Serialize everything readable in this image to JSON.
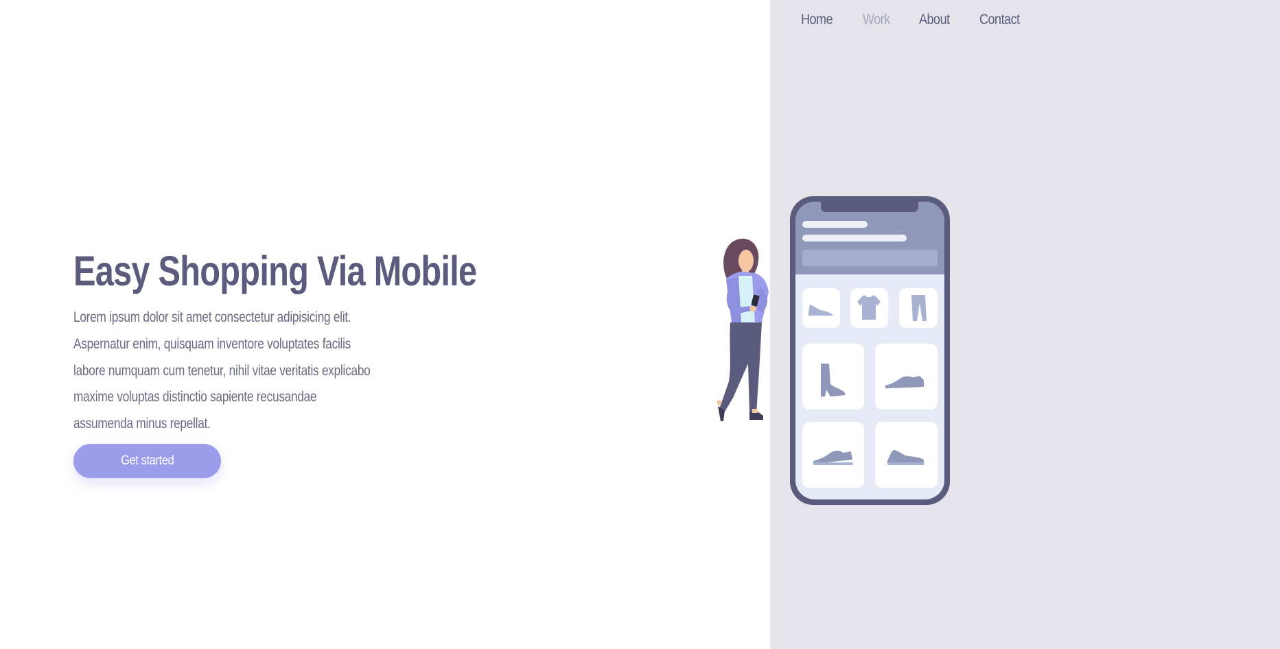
{
  "nav": {
    "items": [
      {
        "label": "Home"
      },
      {
        "label": "Work"
      },
      {
        "label": "About"
      },
      {
        "label": "Contact"
      }
    ]
  },
  "hero": {
    "title": "Easy Shopping Via Mobile",
    "description": "Lorem ipsum dolor sit amet consectetur adipisicing elit. Aspernatur enim, quisquam inventore voluptates facilis labore numquam cum tenetur, nihil vitae veritatis explicabo maxime voluptas distinctio sapiente recusandae assumenda minus repellat.",
    "cta_label": "Get started"
  },
  "colors": {
    "primary_text": "#5b5b7e",
    "muted_nav": "#a5a5bc",
    "accent": "#9c9cec",
    "panel_bg": "#e4e4ea"
  },
  "illustration": {
    "icons": [
      "shoe-icon",
      "tshirt-icon",
      "pants-icon",
      "boot-icon",
      "sneaker-icon",
      "sneaker-icon",
      "sneaker-icon"
    ]
  }
}
